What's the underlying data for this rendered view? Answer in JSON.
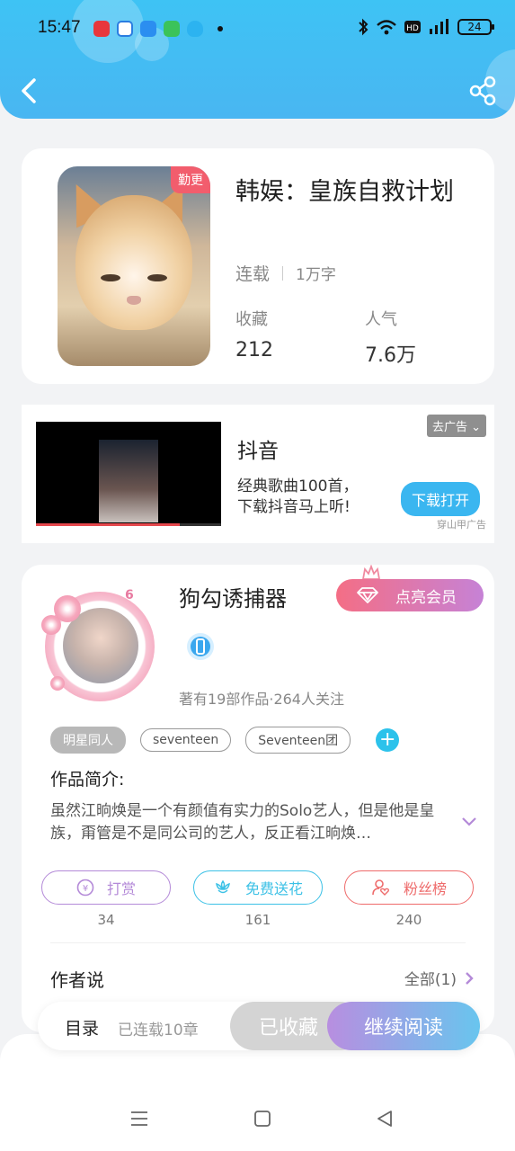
{
  "status_bar": {
    "time": "15:47",
    "battery": "24"
  },
  "book": {
    "title": "韩娱：皇族自救计划",
    "badge": "勤更",
    "status": "连载",
    "word_count": "1万字",
    "favorites_label": "收藏",
    "favorites_value": "212",
    "popularity_label": "人气",
    "popularity_value": "7.6万"
  },
  "ad": {
    "brand": "抖音",
    "desc_line1": "经典歌曲100首，",
    "desc_line2": "下载抖音马上听!",
    "close_label": "去广告",
    "cta_label": "下载打开",
    "source": "穿山甲广告"
  },
  "author": {
    "name": "狗勾诱捕器",
    "level": "6",
    "vip_label": "点亮会员",
    "works_info": "著有19部作品·264人关注",
    "tags": [
      "明星同人",
      "seventeen",
      "Seventeen团"
    ],
    "intro_heading": "作品简介:",
    "intro_text": "虽然江晌焕是一个有颜值有实力的Solo艺人，但是他是皇族，甭管是不是同公司的艺人，反正看江晌焕…",
    "actions": [
      {
        "label": "打赏",
        "count": "34",
        "color": "#b48ad8"
      },
      {
        "label": "免费送花",
        "count": "161",
        "color": "#3cc1e6"
      },
      {
        "label": "粉丝榜",
        "count": "240",
        "color": "#ee6b6b"
      }
    ],
    "author_says": "作者说",
    "all_label": "全部(1)"
  },
  "bottom_bar": {
    "toc_label": "目录",
    "serial_label": "已连载10章",
    "favorited_label": "已收藏",
    "continue_label": "继续阅读"
  }
}
